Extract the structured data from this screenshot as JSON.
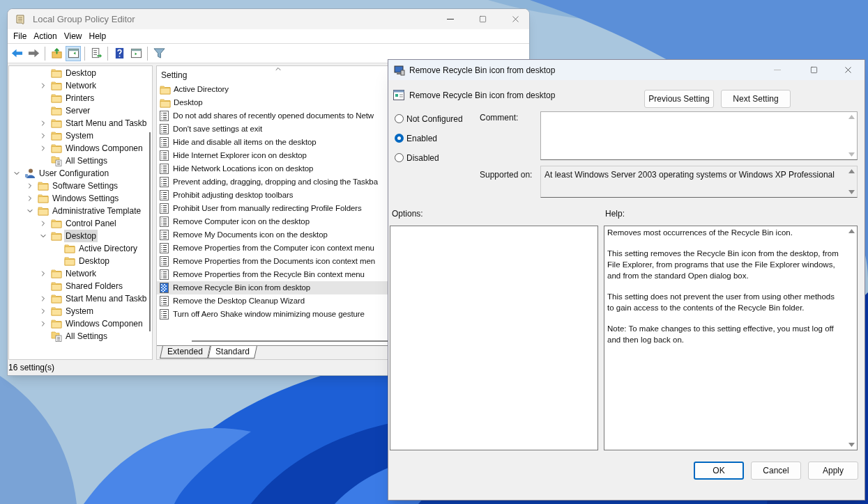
{
  "main_window": {
    "title": "Local Group Policy Editor",
    "menu": [
      "File",
      "Action",
      "View",
      "Help"
    ],
    "toolbar": [
      {
        "pressed": false
      },
      {
        "pressed": false
      },
      {
        "pressed": false
      },
      {
        "pressed": true
      },
      {
        "pressed": false
      },
      {
        "pressed": false
      },
      {
        "pressed": false
      },
      {
        "pressed": false
      }
    ],
    "tree": {
      "upper_items": [
        {
          "label": "Desktop",
          "kind": "folder",
          "selected": false
        },
        {
          "label": "Network",
          "kind": "folder",
          "expanded": false,
          "selected": false
        },
        {
          "label": "Printers",
          "kind": "folder",
          "selected": false
        },
        {
          "label": "Server",
          "kind": "folder",
          "selected": false
        },
        {
          "label": "Start Menu and Taskb",
          "kind": "folder",
          "expanded": false,
          "selected": false
        },
        {
          "label": "System",
          "kind": "folder",
          "expanded": false,
          "selected": false
        },
        {
          "label": "Windows Componen",
          "kind": "folder",
          "expanded": false,
          "selected": false
        },
        {
          "label": "All Settings",
          "kind": "all-settings",
          "selected": false
        }
      ],
      "items": [
        {
          "label": "User Configuration",
          "kind": "user",
          "expanded": true,
          "selected": false,
          "children": [
            {
              "label": "Software Settings",
              "kind": "folder",
              "expanded": false,
              "selected": false
            },
            {
              "label": "Windows Settings",
              "kind": "folder",
              "expanded": false,
              "selected": false
            },
            {
              "label": "Administrative Template",
              "kind": "folder",
              "expanded": true,
              "selected": false,
              "children": [
                {
                  "label": "Control Panel",
                  "kind": "folder",
                  "expanded": false,
                  "selected": false
                },
                {
                  "label": "Desktop",
                  "kind": "folder",
                  "expanded": true,
                  "selected": true,
                  "children": [
                    {
                      "label": "Active Directory",
                      "kind": "folder",
                      "selected": false
                    },
                    {
                      "label": "Desktop",
                      "kind": "folder",
                      "selected": false
                    }
                  ]
                },
                {
                  "label": "Network",
                  "kind": "folder",
                  "expanded": false,
                  "selected": false
                },
                {
                  "label": "Shared Folders",
                  "kind": "folder",
                  "selected": false
                },
                {
                  "label": "Start Menu and Taskb",
                  "kind": "folder",
                  "expanded": false,
                  "selected": false
                },
                {
                  "label": "System",
                  "kind": "folder",
                  "expanded": false,
                  "selected": false
                },
                {
                  "label": "Windows Componen",
                  "kind": "folder",
                  "expanded": false,
                  "selected": false
                },
                {
                  "label": "All Settings",
                  "kind": "all-settings",
                  "selected": false
                }
              ]
            }
          ]
        }
      ]
    },
    "list": {
      "header": "Setting",
      "rows": [
        {
          "label": "Active Directory",
          "kind": "folder",
          "selected": false
        },
        {
          "label": "Desktop",
          "kind": "folder",
          "selected": false
        },
        {
          "label": "Do not add shares of recently opened documents to Netw",
          "kind": "setting",
          "selected": false
        },
        {
          "label": "Don't save settings at exit",
          "kind": "setting",
          "selected": false
        },
        {
          "label": "Hide and disable all items on the desktop",
          "kind": "setting",
          "selected": false
        },
        {
          "label": "Hide Internet Explorer icon on desktop",
          "kind": "setting",
          "selected": false
        },
        {
          "label": "Hide Network Locations icon on desktop",
          "kind": "setting",
          "selected": false
        },
        {
          "label": "Prevent adding, dragging, dropping and closing the Taskba",
          "kind": "setting",
          "selected": false
        },
        {
          "label": "Prohibit adjusting desktop toolbars",
          "kind": "setting",
          "selected": false
        },
        {
          "label": "Prohibit User from manually redirecting Profile Folders",
          "kind": "setting",
          "selected": false
        },
        {
          "label": "Remove Computer icon on the desktop",
          "kind": "setting",
          "selected": false
        },
        {
          "label": "Remove My Documents icon on the desktop",
          "kind": "setting",
          "selected": false
        },
        {
          "label": "Remove Properties from the Computer icon context menu",
          "kind": "setting",
          "selected": false
        },
        {
          "label": "Remove Properties from the Documents icon context men",
          "kind": "setting",
          "selected": false
        },
        {
          "label": "Remove Properties from the Recycle Bin context menu",
          "kind": "setting",
          "selected": false
        },
        {
          "label": "Remove Recycle Bin icon from desktop",
          "kind": "setting",
          "selected": true
        },
        {
          "label": "Remove the Desktop Cleanup Wizard",
          "kind": "setting",
          "selected": false
        },
        {
          "label": "Turn off Aero Shake window minimizing mouse gesture",
          "kind": "setting",
          "selected": false
        }
      ],
      "tabs": [
        {
          "label": "Extended",
          "selected": false
        },
        {
          "label": "Standard",
          "selected": true
        }
      ]
    },
    "status_bar": "16 setting(s)"
  },
  "dialog": {
    "title": "Remove Recycle Bin icon from desktop",
    "heading": "Remove Recycle Bin icon from desktop",
    "nav_buttons": [
      "Previous Setting",
      "Next Setting"
    ],
    "states": [
      {
        "label": "Not Configured",
        "selected": false
      },
      {
        "label": "Enabled",
        "selected": true
      },
      {
        "label": "Disabled",
        "selected": false
      }
    ],
    "comment_label": "Comment:",
    "supported_label": "Supported on:",
    "supported_value": "At least Windows Server 2003 operating systems or Windows XP Professional",
    "options_label": "Options:",
    "help_label": "Help:",
    "help_paragraphs": [
      "Removes most occurrences of the Recycle Bin icon.",
      "This setting removes the Recycle Bin icon from the desktop, from File Explorer, from programs that use the File Explorer windows, and from the standard Open dialog box.",
      "This setting does not prevent the user from using other methods to gain access to the contents of the Recycle Bin folder.",
      "Note: To make changes to this setting effective, you must log off and then log back on."
    ],
    "buttons": [
      {
        "label": "OK",
        "default": true
      },
      {
        "label": "Cancel",
        "default": false
      },
      {
        "label": "Apply",
        "default": false
      }
    ]
  }
}
